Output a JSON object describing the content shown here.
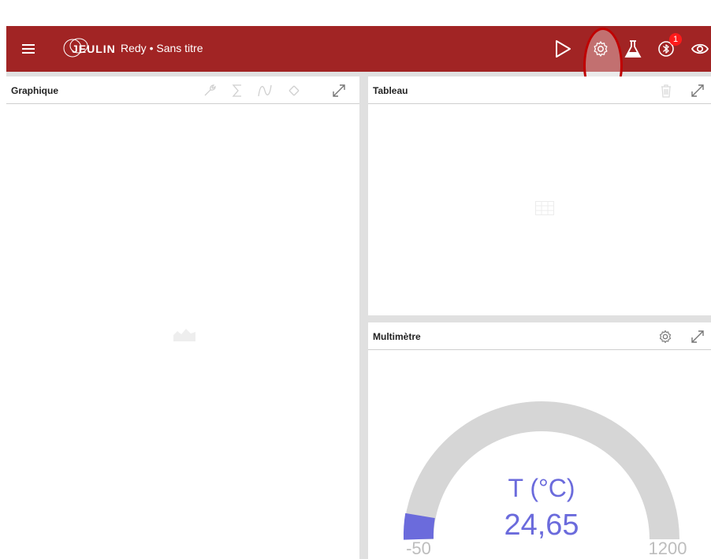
{
  "appbar": {
    "brand": "JEULIN",
    "title": "Redy • Sans titre",
    "bluetooth_badge": "1",
    "colors": {
      "bar": "#a12424",
      "highlight": "#c00000"
    }
  },
  "panels": {
    "graph": {
      "title": "Graphique"
    },
    "table": {
      "title": "Tableau"
    },
    "multimeter": {
      "title": "Multimètre",
      "label": "T (°C)",
      "value": "24,65",
      "min": "-50",
      "max": "1200",
      "value_color": "#6b6bdc",
      "track_color": "#d6d6d6"
    }
  }
}
